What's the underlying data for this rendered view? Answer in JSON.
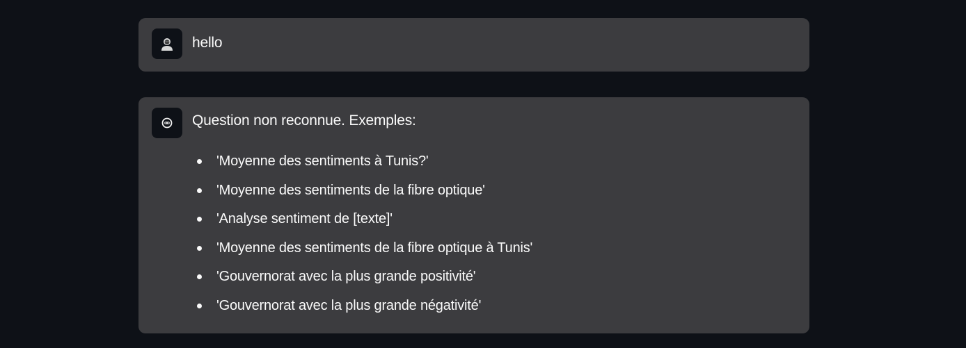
{
  "conversation": {
    "user_message": {
      "avatar_icon": "user-icon",
      "text": "hello"
    },
    "assistant_message": {
      "avatar_icon": "bot-icon",
      "text": "Question non reconnue. Exemples:",
      "examples": [
        "'Moyenne des sentiments à Tunis?'",
        "'Moyenne des sentiments de la fibre optique'",
        "'Analyse sentiment de [texte]'",
        "'Moyenne des sentiments de la fibre optique à Tunis'",
        "'Gouvernorat avec la plus grande positivité'",
        "'Gouvernorat avec la plus grande négativité'"
      ]
    }
  },
  "colors": {
    "background": "#0e1117",
    "message_background": "#3c3c3f",
    "text": "#fafafa"
  }
}
